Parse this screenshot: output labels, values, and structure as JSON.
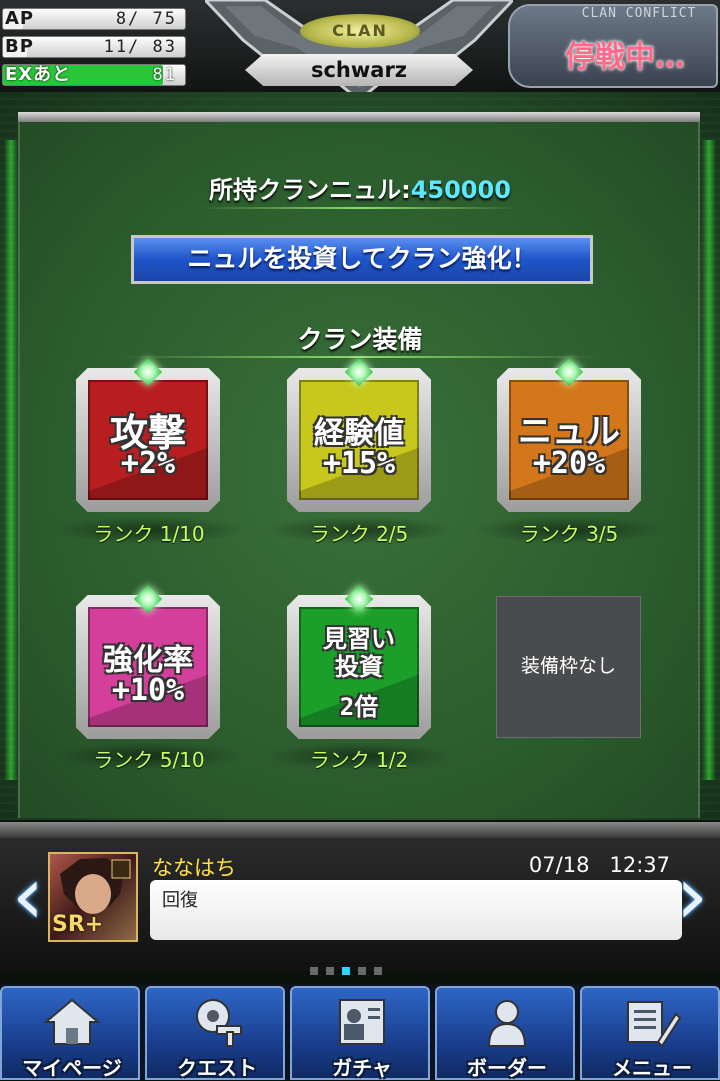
{
  "header": {
    "stats": [
      {
        "label": "AP",
        "value": "8/ 75",
        "fill": 0.11,
        "color": "#f2f2f2"
      },
      {
        "label": "BP",
        "value": "11/ 83",
        "fill": 0.13,
        "color": "#f2f2f2"
      },
      {
        "label": "EXあと",
        "value": "81",
        "fill": 0.88,
        "color": "#29c63a"
      }
    ],
    "clan_tag": "CLAN",
    "clan_name": "schwarz",
    "conflict_caption": "CLAN CONFLICT",
    "conflict_status": "停戦中…"
  },
  "main": {
    "holdings_label": "所持クランニュル:",
    "holdings_value": "450000",
    "invest_button": "ニュルを投資してクラン強化！",
    "equip_heading": "クラン装備",
    "cards": [
      {
        "name": "攻撃",
        "bonus": "+2%",
        "rank": "ランク 1/10",
        "color": "#b81d1f"
      },
      {
        "name": "経験値",
        "bonus": "+15%",
        "rank": "ランク 2/5",
        "color": "#c7c71d"
      },
      {
        "name": "ニュル",
        "bonus": "+20%",
        "rank": "ランク 3/5",
        "color": "#d4771a"
      },
      {
        "name": "強化率",
        "bonus": "+10%",
        "rank": "ランク 5/10",
        "color": "#d33f9a"
      },
      {
        "name": "見習い投資",
        "bonus": "2倍",
        "rank": "ランク 1/2",
        "color": "#1c9f2a"
      }
    ],
    "empty_slot": "装備枠なし"
  },
  "message": {
    "user_name": "ななはち",
    "date": "07/18",
    "time": "12:37",
    "text": "回復",
    "avatar_badge": "SR+",
    "pager_active": 2,
    "pager_total": 5
  },
  "tabs": [
    {
      "label": "マイページ",
      "icon": "home-icon"
    },
    {
      "label": "クエスト",
      "icon": "quest-gear-icon"
    },
    {
      "label": "ガチャ",
      "icon": "gacha-card-icon"
    },
    {
      "label": "ボーダー",
      "icon": "border-person-icon"
    },
    {
      "label": "メニュー",
      "icon": "menu-tools-icon"
    }
  ]
}
